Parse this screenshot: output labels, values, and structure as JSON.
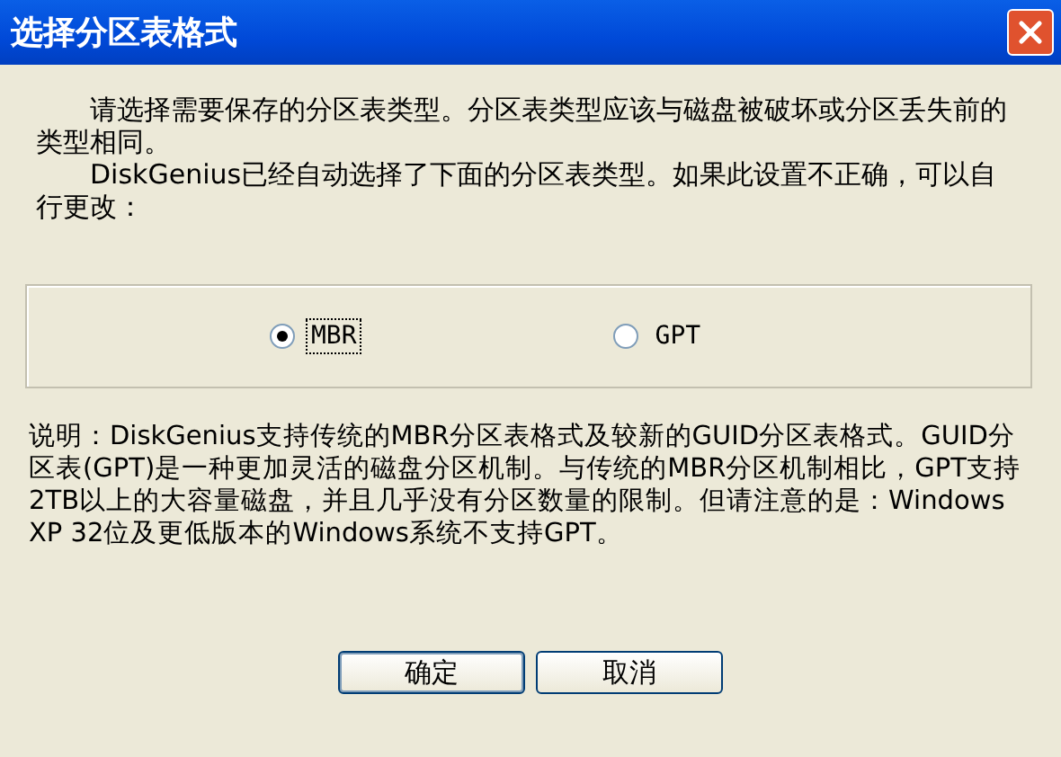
{
  "window": {
    "title": "选择分区表格式"
  },
  "intro": [
    "请选择需要保存的分区表类型。分区表类型应该与磁盘被破坏或分区丢失前的类型相同。",
    "DiskGenius已经自动选择了下面的分区表类型。如果此设置不正确，可以自行更改："
  ],
  "options": [
    {
      "label": "MBR",
      "selected": true
    },
    {
      "label": "GPT",
      "selected": false
    }
  ],
  "note": "说明：DiskGenius支持传统的MBR分区表格式及较新的GUID分区表格式。GUID分区表(GPT)是一种更加灵活的磁盘分区机制。与传统的MBR分区机制相比，GPT支持2TB以上的大容量磁盘，并且几乎没有分区数量的限制。但请注意的是：Windows XP 32位及更低版本的Windows系统不支持GPT。",
  "buttons": [
    "确定",
    "取消"
  ]
}
